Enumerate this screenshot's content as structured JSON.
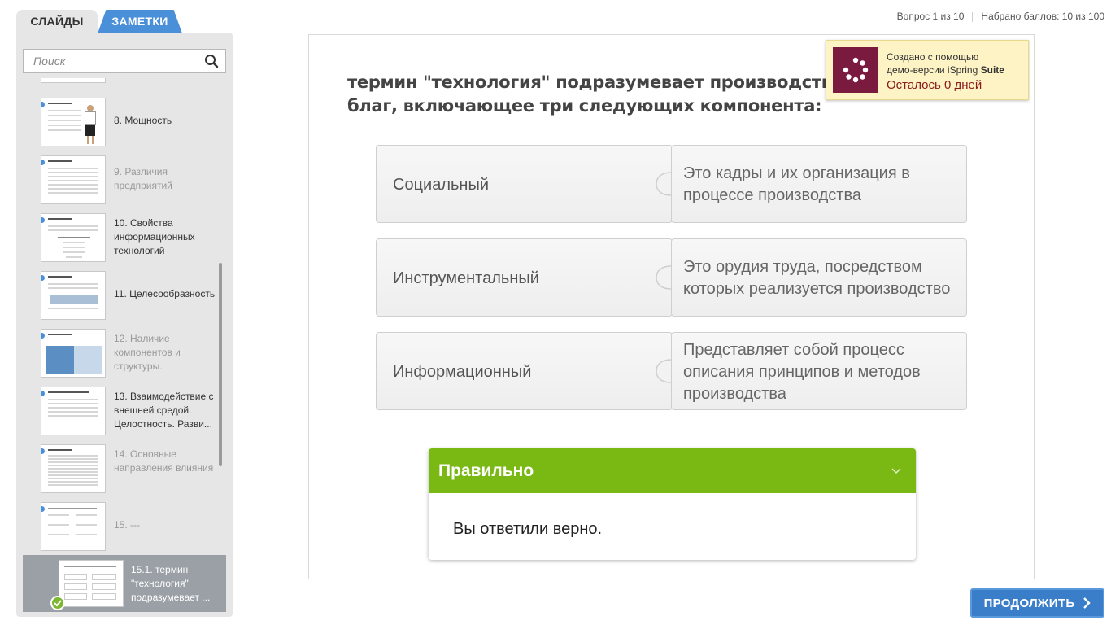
{
  "tabs": {
    "slides": "СЛАЙДЫ",
    "notes": "ЗАМЕТКИ"
  },
  "search": {
    "placeholder": "Поиск"
  },
  "slides": [
    {
      "label": "8. Мощность",
      "dim": false
    },
    {
      "label": "9. Различия предприятий",
      "dim": true
    },
    {
      "label": "10. Свойства информационных технологий",
      "dim": false
    },
    {
      "label": "11. Целесообразность",
      "dim": false
    },
    {
      "label": "12. Наличие компонентов и структуры.",
      "dim": true
    },
    {
      "label": "13. Взаимодействие с внешней средой. Целостность. Разви...",
      "dim": false
    },
    {
      "label": "14. Основные направления влияния",
      "dim": true
    },
    {
      "label": "15. ---",
      "dim": true
    }
  ],
  "active_slide": {
    "label": "15.1. термин \"технология\" подразумевает ..."
  },
  "status": {
    "question": "Вопрос 1 из 10",
    "score": "Набрано баллов: 10 из 100"
  },
  "demo": {
    "line1": "Создано с помощью",
    "line2a": "демо-версии iSpring ",
    "line2b": "Suite",
    "remaining": "Осталось 0 дней"
  },
  "question": "термин \"технология\" подразумевает производство благ, включающее три следующих компонента:",
  "pairs": [
    {
      "left": "Социальный",
      "right": "Это кадры и их организация в процессе производства"
    },
    {
      "left": "Инструментальный",
      "right": "Это орудия труда, посредством которых реализуется производство"
    },
    {
      "left": "Информационный",
      "right": "Представляет собой процесс описания принципов и методов производства"
    }
  ],
  "feedback": {
    "title": "Правильно",
    "message": "Вы ответили верно."
  },
  "continue": {
    "label": "ПРОДОЛЖИТЬ"
  },
  "colors": {
    "accent": "#4a90d9",
    "correct": "#7ab814",
    "button": "#3a7dc9"
  },
  "icons": [
    "search-icon",
    "chevron-down-icon",
    "check-icon",
    "chevron-right-icon",
    "ispring-logo-icon",
    "expand-arrow-icon"
  ]
}
